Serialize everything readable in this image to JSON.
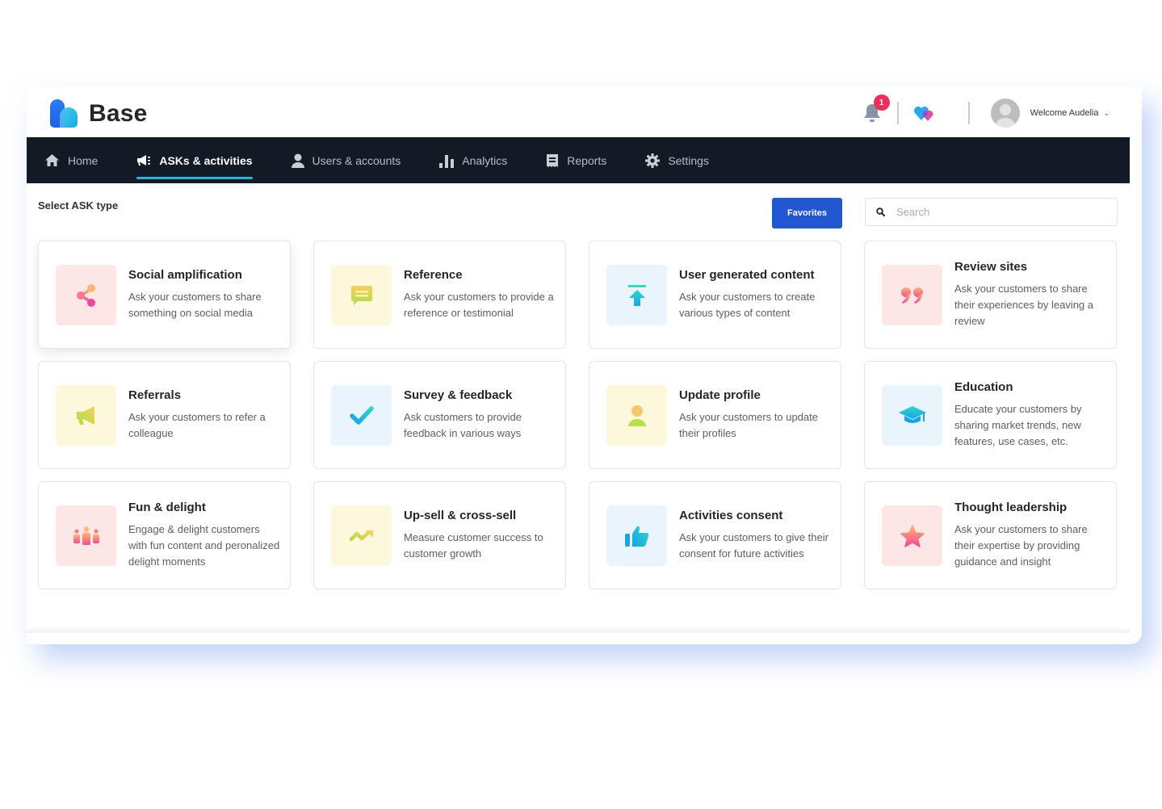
{
  "app": {
    "name": "Base",
    "logo_icon": "base-logo-icon"
  },
  "header": {
    "notifications": {
      "icon": "bell-icon",
      "count": "1",
      "badge_color": "#ef2f5b"
    },
    "hearts_icon": "hearts-icon",
    "user": {
      "avatar_icon": "avatar-placeholder-icon",
      "welcome_text": "Welcome Audelia",
      "menu_icon": "chevron-down-icon"
    }
  },
  "nav": {
    "items": [
      {
        "label": "Home",
        "icon": "home-icon",
        "active": false
      },
      {
        "label": "ASKs & activities",
        "icon": "megaphone-icon",
        "active": true
      },
      {
        "label": "Users & accounts",
        "icon": "user-icon",
        "active": false
      },
      {
        "label": "Analytics",
        "icon": "bar-chart-icon",
        "active": false
      },
      {
        "label": "Reports",
        "icon": "receipt-icon",
        "active": false
      },
      {
        "label": "Settings",
        "icon": "gear-icon",
        "active": false
      }
    ],
    "background": "#131a26",
    "active_underline_color": "#21b7d9"
  },
  "main": {
    "section_title": "Select ASK type",
    "favorites_label": "Favorites",
    "favorites_color": "#2157d1",
    "search": {
      "placeholder": "Search",
      "value": "",
      "icon": "search-icon"
    },
    "cards": [
      {
        "title": "Social amplification",
        "description": "Ask your customers to share something on social media",
        "icon": "share-icon",
        "tone": "pink"
      },
      {
        "title": "Reference",
        "description": "Ask your customers to provide a reference or testimonial",
        "icon": "chat-bubble-icon",
        "tone": "yellow"
      },
      {
        "title": "User generated content",
        "description": "Ask your customers to create various types of content",
        "icon": "upload-arrow-icon",
        "tone": "blue"
      },
      {
        "title": "Review sites",
        "description": "Ask your customers to share their experiences by leaving a review",
        "icon": "quote-icon",
        "tone": "pink"
      },
      {
        "title": "Referrals",
        "description": "Ask your customers to refer a colleague",
        "icon": "megaphone-icon",
        "tone": "yellow"
      },
      {
        "title": "Survey & feedback",
        "description": "Ask customers to provide feedback in various ways",
        "icon": "checkmark-icon",
        "tone": "blue"
      },
      {
        "title": "Update profile",
        "description": "Ask your customers to update their profiles",
        "icon": "user-icon",
        "tone": "yellow"
      },
      {
        "title": "Education",
        "description": "Educate your customers by sharing market trends, new features, use cases, etc.",
        "icon": "graduation-cap-icon",
        "tone": "blue"
      },
      {
        "title": "Fun & delight",
        "description": "Engage & delight customers with fun content and peronalized delight moments",
        "icon": "group-icon",
        "tone": "pink"
      },
      {
        "title": "Up-sell & cross-sell",
        "description": "Measure customer success to customer growth",
        "icon": "trend-up-icon",
        "tone": "yellow"
      },
      {
        "title": "Activities consent",
        "description": "Ask your customers to give their consent for future activities",
        "icon": "thumbs-up-icon",
        "tone": "blue"
      },
      {
        "title": "Thought leadership",
        "description": "Ask your customers to share their expertise by providing guidance and insight",
        "icon": "star-icon",
        "tone": "pink"
      }
    ]
  }
}
